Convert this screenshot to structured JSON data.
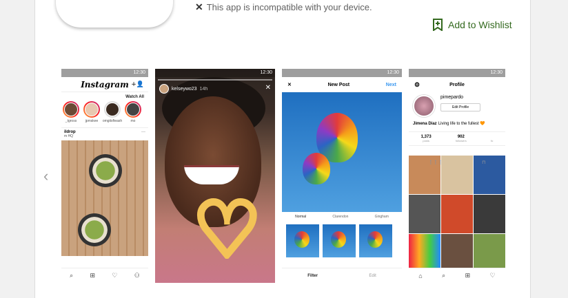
{
  "header": {
    "compat_icon": "close-icon",
    "compat_text": "This app is incompatible with your device.",
    "wishlist_icon": "bookmark-plus-icon",
    "wishlist_label": "Add to Wishlist"
  },
  "nav": {
    "prev_icon": "chevron-left-icon"
  },
  "screenshots": {
    "status_time": "12:30",
    "feed": {
      "title": "Instagram",
      "watch_all": "Watch All",
      "stories": [
        {
          "name": "_tgross"
        },
        {
          "name": "jpmskee"
        },
        {
          "name": "omgitsfteash"
        },
        {
          "name": "mo"
        }
      ],
      "post_user": "ildrop",
      "post_location": "m HQ",
      "post_more": "···"
    },
    "story": {
      "user": "kelseywo23",
      "time": "14h"
    },
    "new_post": {
      "close": "✕",
      "title": "New Post",
      "next": "Next",
      "filters": [
        "Normal",
        "Clarendon",
        "Gingham"
      ],
      "tab_filter": "Filter",
      "tab_edit": "Edit"
    },
    "profile": {
      "title": "Profile",
      "username": "pimepardo",
      "edit_button": "Edit Profile",
      "bio_name": "Jimena Diaz",
      "bio_text": "Living life to the fullest 🧡",
      "posts_count": "1,373",
      "posts_label": "posts",
      "followers_count": "902",
      "followers_label": "followers",
      "following_label": "fo"
    }
  },
  "colors": {
    "wishlist": "#33691e",
    "link": "#3897f0"
  }
}
